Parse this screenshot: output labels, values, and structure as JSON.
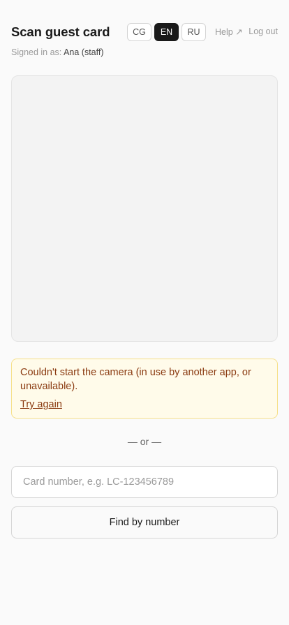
{
  "header": {
    "title": "Scan guest card",
    "languages": [
      {
        "code": "CG",
        "active": false
      },
      {
        "code": "EN",
        "active": true
      },
      {
        "code": "RU",
        "active": false
      }
    ],
    "help_label": "Help ↗",
    "logout_label": "Log out"
  },
  "session": {
    "signed_in_label": "Signed in as:",
    "user": "Ana (staff)"
  },
  "camera": {
    "error_message": "Couldn't start the camera (in use by another app, or unavailable).",
    "retry_label": "Try again"
  },
  "manual": {
    "divider_label": "— or —",
    "card_placeholder": "Card number, e.g. LC-123456789",
    "card_value": "",
    "find_label": "Find by number"
  }
}
